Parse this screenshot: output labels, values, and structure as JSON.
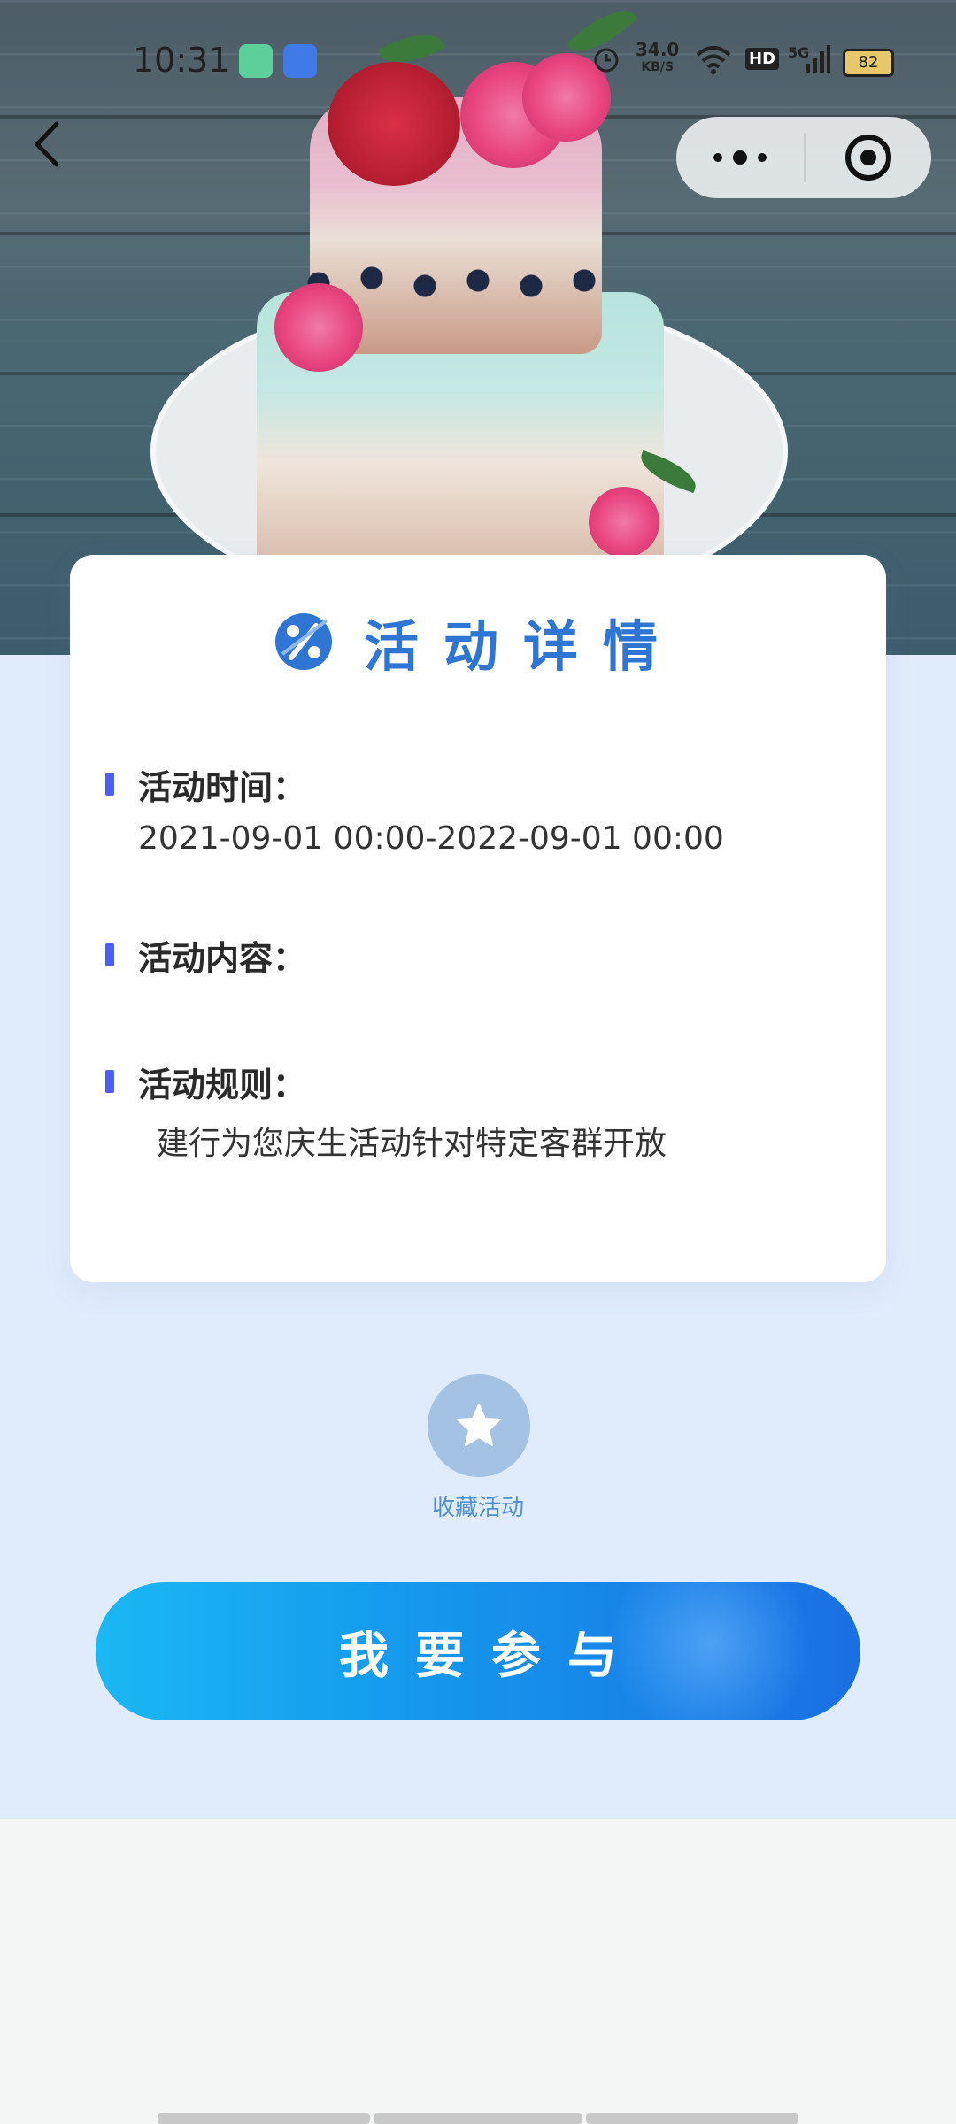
{
  "status_bar": {
    "time": "10:31",
    "net_speed": "34.0",
    "net_unit": "KB/S",
    "hd": "HD",
    "signal": "5G",
    "battery": "82"
  },
  "card": {
    "title": "活动详情",
    "fields": [
      {
        "label": "活动时间：",
        "value": "2021-09-01 00:00-2022-09-01 00:00"
      },
      {
        "label": "活动内容：",
        "value": ""
      },
      {
        "label": "活动规则：",
        "value": "建行为您庆生活动针对特定客群开放"
      }
    ]
  },
  "favorite": {
    "label": "收藏活动"
  },
  "join_button": {
    "label": "我要参与"
  },
  "colors": {
    "primary": "#2f76d4",
    "panel": "#e0ecfc",
    "marker": "#4d5ef0"
  }
}
